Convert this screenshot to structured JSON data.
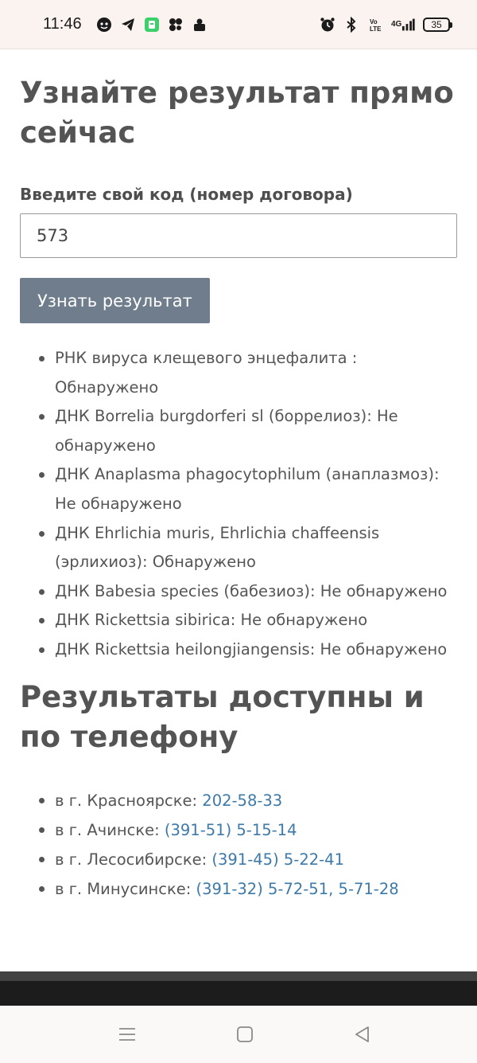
{
  "status_bar": {
    "time": "11:46",
    "battery_level": "35",
    "network_label": "4G"
  },
  "main": {
    "title": "Узнайте результат прямо сейчас",
    "code_label": "Введите свой код (номер договора)",
    "code_value": "573",
    "submit_label": "Узнать результат",
    "results": [
      "РНК вируса клещевого энцефалита : Обнаружено",
      "ДНК Borrelia burgdorferi sl (боррелиоз): Не обнаружено",
      "ДНК Anaplasma phagocytophilum (анаплазмоз): Не обнаружено",
      "ДНК Ehrlichia muris, Ehrlichia chaffeensis (эрлихиоз): Обнаружено",
      "ДНК Babesia species (бабезиоз): Не обнаружено",
      "ДНК Rickettsia sibirica: Не обнаружено",
      "ДНК Rickettsia heilongjiangensis: Не обнаружено"
    ],
    "phone_section_title": "Результаты доступны и по телефону",
    "phones": [
      {
        "city": "в г. Красноярске: ",
        "numbers": [
          "202-58-33"
        ]
      },
      {
        "city": "в г. Ачинске: ",
        "numbers": [
          "(391-51) 5-15-14"
        ]
      },
      {
        "city": "в г. Лесосибирске: ",
        "numbers": [
          "(391-45) 5-22-41"
        ]
      },
      {
        "city": "в г. Минусинске: ",
        "numbers": [
          "(391-32) 5-72-51",
          "5-71-28"
        ],
        "separator": ", "
      }
    ]
  },
  "icons": {
    "status_left": [
      "chat-bubble-icon",
      "telegram-icon",
      "app-icon",
      "messenger-icon",
      "notification-icon"
    ],
    "status_right": [
      "alarm-icon",
      "bluetooth-icon",
      "volte-icon",
      "signal-icon",
      "battery-icon"
    ],
    "nav": [
      "menu-icon",
      "home-icon",
      "back-icon"
    ]
  },
  "colors": {
    "button": "#6f7d8c",
    "link": "#3d79a9",
    "text": "#555555",
    "status_bar_bg": "#fbf3ef"
  }
}
